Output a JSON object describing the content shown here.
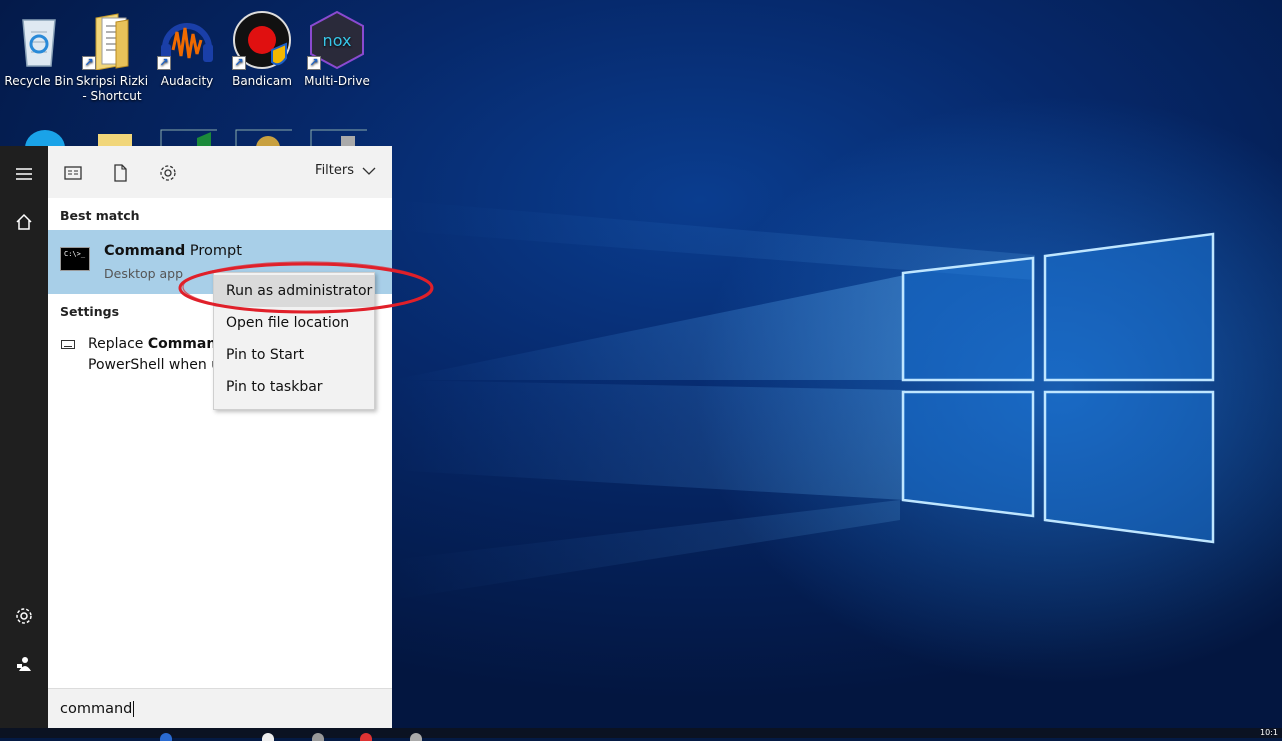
{
  "desktop": {
    "icons": [
      {
        "label": "Recycle Bin",
        "icon": "recycle-bin-icon"
      },
      {
        "label": "Skripsi Rizki - Shortcut",
        "icon": "folder-icon"
      },
      {
        "label": "Audacity",
        "icon": "audacity-icon"
      },
      {
        "label": "Bandicam",
        "icon": "bandicam-icon"
      },
      {
        "label": "Multi-Drive",
        "icon": "nox-icon",
        "logo_text": "nox"
      }
    ]
  },
  "start_rail": {
    "icons": [
      "hamburger-menu-icon",
      "home-icon",
      "settings-gear-icon",
      "user-account-icon"
    ]
  },
  "search_panel": {
    "toolbar": {
      "icons": [
        "apps-filter-icon",
        "documents-filter-icon",
        "settings-filter-icon"
      ],
      "filters_label": "Filters"
    },
    "best_match": {
      "heading": "Best match",
      "title_bold": "Command",
      "title_rest": " Prompt",
      "subtitle": "Desktop app",
      "icon_text": "C:\\>_"
    },
    "settings": {
      "heading": "Settings",
      "line1_prefix": "Replace ",
      "line1_bold": "Command",
      "line2": "PowerShell when u"
    },
    "search_box": {
      "value": "command"
    }
  },
  "context_menu": {
    "items": [
      {
        "label": "Run as administrator",
        "highlighted": true
      },
      {
        "label": "Open file location",
        "highlighted": false
      },
      {
        "label": "Pin to Start",
        "highlighted": false
      },
      {
        "label": "Pin to taskbar",
        "highlighted": false
      }
    ],
    "annotation_color": "#e0202a"
  },
  "taskbar": {
    "clock": "10:1"
  },
  "colors": {
    "selection": "#a8cfe8",
    "rail": "#1f1f1f",
    "panel": "#f2f2f2",
    "wallpaper_glow": "#2a8cf0"
  }
}
